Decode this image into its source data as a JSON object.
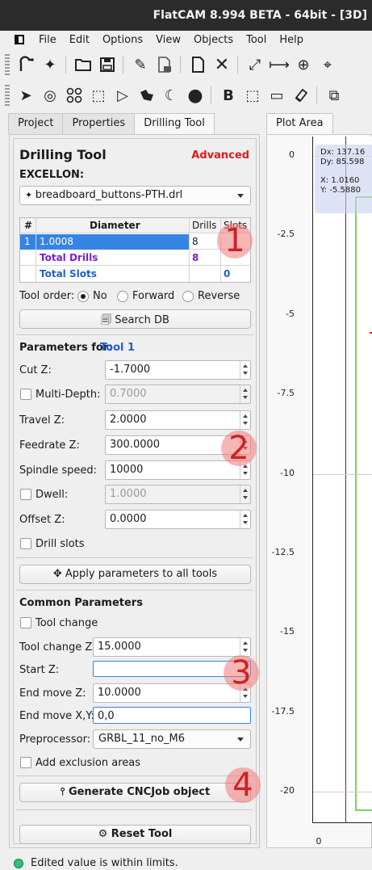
{
  "window": {
    "title": "FlatCAM 8.994 BETA - 64bit - [3D]"
  },
  "menu": [
    "File",
    "Edit",
    "Options",
    "View",
    "Objects",
    "Tool",
    "Help"
  ],
  "toolbar1": [
    "drill-tool-icon",
    "sparkle-icon",
    "open-folder-icon",
    "save-icon",
    "pencil-icon",
    "copy-doc-icon",
    "new-doc-icon",
    "delete-x-icon",
    "expand-icon",
    "distance-icon",
    "crosshair-icon",
    "target-icon"
  ],
  "toolbar2": [
    "pointer-icon",
    "circle-target-icon",
    "grid-icon",
    "select-box-icon",
    "polygon-icon",
    "shape-icon",
    "moon-icon",
    "disc-icon",
    "bold-icon",
    "rect-select-icon",
    "rect-icon",
    "eraser-icon",
    "move-icon"
  ],
  "tabs": {
    "project": "Project",
    "properties": "Properties",
    "drilling": "Drilling Tool",
    "plot": "Plot Area"
  },
  "panel": {
    "title": "Drilling Tool",
    "mode": "Advanced",
    "excellon_label": "EXCELLON:",
    "excellon_file": "breadboard_buttons-PTH.drl",
    "table": {
      "headers": [
        "#",
        "Diameter",
        "Drills",
        "Slots"
      ],
      "row": {
        "num": "1",
        "diameter": "1.0008",
        "drills": "8",
        "slots": ""
      },
      "total_drills_label": "Total Drills",
      "total_drills": "8",
      "total_slots_label": "Total Slots",
      "total_slots": "0"
    },
    "tool_order_label": "Tool order:",
    "tool_order_options": [
      "No",
      "Forward",
      "Reverse"
    ],
    "search_db": "Search DB",
    "params_for_label": "Parameters for:",
    "params_for_tool": "Tool 1",
    "cut_z_label": "Cut Z:",
    "cut_z": "-1.7000",
    "multidepth_label": "Multi-Depth:",
    "multidepth": "0.7000",
    "travel_z_label": "Travel Z:",
    "travel_z": "2.0000",
    "feedrate_label": "Feedrate Z:",
    "feedrate": "300.0000",
    "spindle_label": "Spindle speed:",
    "spindle": "10000",
    "dwell_label": "Dwell:",
    "dwell": "1.0000",
    "offset_label": "Offset Z:",
    "offset": "0.0000",
    "drill_slots_label": "Drill slots",
    "apply_all": "Apply parameters to all tools",
    "common_label": "Common Parameters",
    "toolchange_label": "Tool change",
    "toolchange_z_label": "Tool change Z:",
    "toolchange_z": "15.0000",
    "start_z_label": "Start Z:",
    "start_z": "",
    "end_move_z_label": "End move Z:",
    "end_move_z": "10.0000",
    "end_move_xy_label": "End move X,Y:",
    "end_move_xy": "0,0",
    "preprocessor_label": "Preprocessor:",
    "preprocessor": "GRBL_11_no_M6",
    "exclusion_label": "Add exclusion areas",
    "generate": "Generate CNCJob object",
    "reset": "Reset Tool"
  },
  "annotations": [
    "1",
    "2",
    "3",
    "4"
  ],
  "plot": {
    "dx_label": "Dx:",
    "dx": "137.16",
    "dy_label": "Dy:",
    "dy": "85.598",
    "x_label": "X:",
    "x": "1.0160",
    "y_label": "Y:",
    "y": "-5.5880",
    "y_ticks": [
      "0",
      "-2.5",
      "-5",
      "-7.5",
      "-10",
      "-12.5",
      "-15",
      "-17.5",
      "-20"
    ],
    "x_tick": "0"
  },
  "status": {
    "text": "Edited value is within limits.",
    "color": "#2ec27e"
  }
}
